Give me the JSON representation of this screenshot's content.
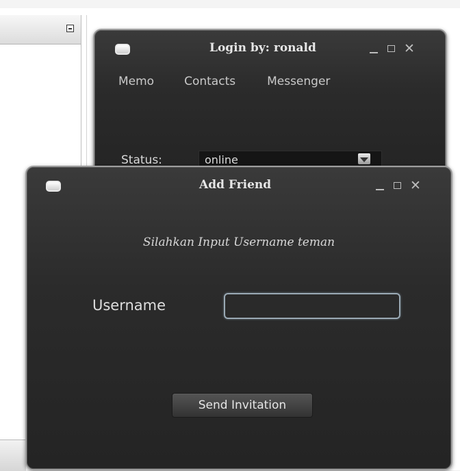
{
  "login_window": {
    "title": "Login by: ronald",
    "menu": [
      {
        "label": "Memo"
      },
      {
        "label": "Contacts"
      },
      {
        "label": "Messenger"
      }
    ],
    "status_label": "Status:",
    "status_value": "online"
  },
  "add_friend_window": {
    "title": "Add Friend",
    "instruction": "Silahkan Input Username teman",
    "username_label": "Username",
    "username_value": "",
    "send_button_label": "Send Invitation"
  },
  "icons": {
    "window_icon": "window-icon",
    "minimize": "minimize-icon",
    "maximize": "maximize-icon",
    "close": "close-icon",
    "dropdown": "chevron-down-icon"
  },
  "colors": {
    "window_bg": "#2b2b2b",
    "window_border": "#9e9e9e",
    "text": "#d8d8d8",
    "input_border": "#9aa9b4"
  }
}
